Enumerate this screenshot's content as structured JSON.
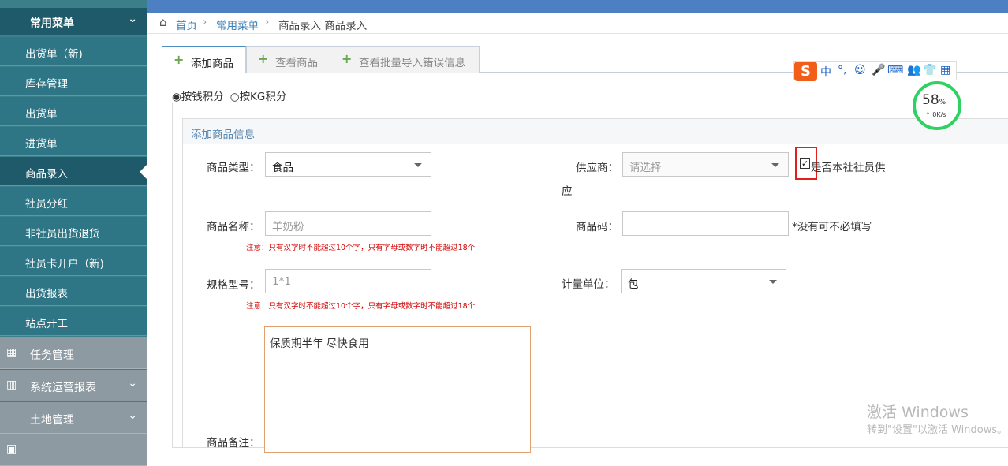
{
  "sidebar": {
    "header": "常用菜单",
    "items": [
      {
        "label": "出货单（新)"
      },
      {
        "label": "库存管理"
      },
      {
        "label": "出货单"
      },
      {
        "label": "进货单"
      },
      {
        "label": "商品录入",
        "active": true
      },
      {
        "label": "社员分红"
      },
      {
        "label": "非社员出货退货"
      },
      {
        "label": "社员卡开户（新)"
      },
      {
        "label": "出货报表"
      },
      {
        "label": "站点开工"
      }
    ],
    "groups": [
      {
        "label": "任务管理",
        "icon": "grid-icon"
      },
      {
        "label": "系统运营报表",
        "icon": "bar-chart-icon"
      },
      {
        "label": "土地管理",
        "icon": ""
      }
    ]
  },
  "breadcrumb": {
    "home": "首页",
    "level2": "常用菜单",
    "current": "商品录入 商品录入"
  },
  "tabs": [
    {
      "label": "添加商品",
      "active": true
    },
    {
      "label": "查看商品"
    },
    {
      "label": "查看批量导入错误信息"
    }
  ],
  "points_mode": {
    "option1": "按钱积分",
    "option2": "按KG积分",
    "selected": "option1"
  },
  "panel": {
    "title": "添加商品信息"
  },
  "form": {
    "product_type": {
      "label": "商品类型：",
      "value": "食品"
    },
    "supplier": {
      "label": "供应商：",
      "placeholder": "请选择"
    },
    "member_supply": {
      "label_part1": "是否本社社员供",
      "label_part2": "应",
      "checked": true
    },
    "product_name": {
      "label": "商品名称：",
      "placeholder": "羊奶粉"
    },
    "product_code": {
      "label": "商品码：",
      "value": "",
      "hint": "*没有可不必填写"
    },
    "spec": {
      "label": "规格型号：",
      "placeholder": "1*1"
    },
    "unit": {
      "label": "计量单位：",
      "value": "包"
    },
    "note_text": "注意：只有汉字时不能超过10个字，只有字母或数字时不能超过18个",
    "remark": {
      "label": "商品备注：",
      "value": "保质期半年 尽快食用"
    }
  },
  "ime": {
    "logo": "S",
    "chars": [
      "中",
      "°,",
      "☺",
      "🎤",
      "⌨",
      "👥",
      "👕",
      "▦"
    ]
  },
  "speed_widget": {
    "percent": "58",
    "unit": "%",
    "rate": "0K/s"
  },
  "os_watermark": {
    "line1": "激活 Windows",
    "line2": "转到\"设置\"以激活 Windows。"
  }
}
